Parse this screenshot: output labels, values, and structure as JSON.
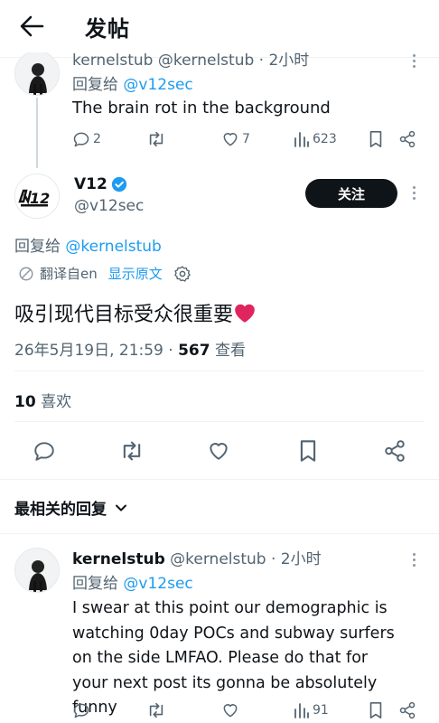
{
  "header": {
    "title": "发帖"
  },
  "top_reply": {
    "author_partial": "kernelstub @kernelstub · 2小时",
    "reply_to_prefix": "回复给",
    "reply_to_handle": "@v12sec",
    "text": "The brain rot in the background",
    "replies": "2",
    "likes": "7",
    "views": "623"
  },
  "main_post": {
    "name": "V12",
    "verified": true,
    "handle": "@v12sec",
    "follow_label": "关注",
    "reply_to_prefix": "回复给",
    "reply_to_handle": "@kernelstub",
    "translated_from": "翻译自en",
    "show_original": "显示原文",
    "text": "吸引现代目标受众很重要",
    "timestamp": "26年5月19日, 21:59 · ",
    "view_count": "567",
    "view_label": " 查看",
    "likes_count": "10",
    "likes_label": " 喜欢"
  },
  "sort": {
    "label": "最相关的回复"
  },
  "bottom_reply": {
    "name": "kernelstub",
    "handle": "@kernelstub",
    "time": " · 2小时",
    "reply_to_prefix": "回复给",
    "reply_to_handle": "@v12sec",
    "text": "I swear at this point our demographic is watching 0day POCs and subway surfers on the side LMFAO. Please do that for your next post its gonna be absolutely funny",
    "views": "91"
  },
  "colors": {
    "accent": "#1d9bf0",
    "muted": "#536471",
    "heart": "#e0245e"
  }
}
